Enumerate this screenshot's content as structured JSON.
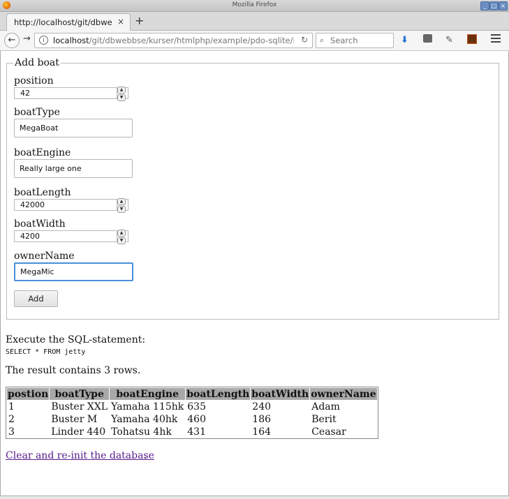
{
  "window": {
    "title": "Mozilla Firefox"
  },
  "tab": {
    "label": "http://localhost/git/dbwebb",
    "close": "×",
    "new_tab": "+"
  },
  "nav": {
    "url_host": "localhost",
    "url_path": "/git/dbwebbse/kurser/htmlphp/example/pdo-sqlite/i",
    "search_placeholder": "Search"
  },
  "form": {
    "legend": "Add boat",
    "fields": [
      {
        "label": "position",
        "value": "42"
      },
      {
        "label": "boatType",
        "value": "MegaBoat"
      },
      {
        "label": "boatEngine",
        "value": "Really large one"
      },
      {
        "label": "boatLength",
        "value": "42000"
      },
      {
        "label": "boatWidth",
        "value": "4200"
      },
      {
        "label": "ownerName",
        "value": "MegaMic"
      }
    ],
    "submit_label": "Add"
  },
  "sql": {
    "intro": "Execute the SQL-statement:",
    "statement": "SELECT * FROM jetty",
    "result_text": "The result contains 3 rows."
  },
  "table": {
    "headers": [
      "postion",
      "boatType",
      "boatEngine",
      "boatLength",
      "boatWidth",
      "ownerName"
    ],
    "rows": [
      [
        "1",
        "Buster XXL",
        "Yamaha 115hk",
        "635",
        "240",
        "Adam"
      ],
      [
        "2",
        "Buster M",
        "Yamaha 40hk",
        "460",
        "186",
        "Berit"
      ],
      [
        "3",
        "Linder 440",
        "Tohatsu 4hk",
        "431",
        "164",
        "Ceasar"
      ]
    ]
  },
  "link": {
    "text": "Clear and re-init the database",
    "suffix": "."
  },
  "icons": {
    "back": "back-arrow-icon",
    "forward": "forward-arrow-icon",
    "info": "info-icon",
    "reload": "reload-icon",
    "search": "search-icon",
    "downloads": "download-arrow-icon",
    "menu": "hamburger-menu-icon"
  },
  "colors": {
    "focus": "#4a90d9",
    "link_visited": "#551a8b",
    "table_header": "#a8a8a8"
  }
}
